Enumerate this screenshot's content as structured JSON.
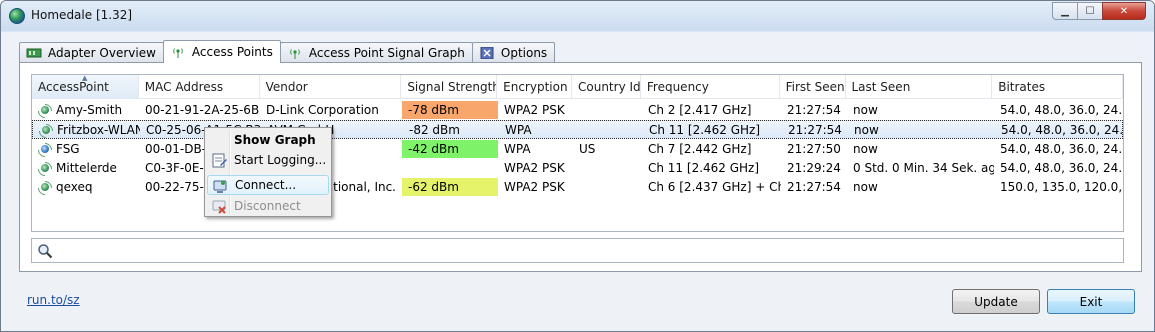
{
  "window": {
    "title": "Homedale [1.32]"
  },
  "title_buttons": {
    "minimize": "▁",
    "maximize": "☐",
    "close": "✕"
  },
  "tabs": [
    {
      "label": "Adapter Overview",
      "icon": "adapter-icon"
    },
    {
      "label": "Access Points",
      "icon": "antenna-icon"
    },
    {
      "label": "Access Point Signal Graph",
      "icon": "antenna-icon"
    },
    {
      "label": "Options",
      "icon": "options-icon"
    }
  ],
  "columns": [
    "AccessPoint",
    "MAC Address",
    "Vendor",
    "Signal Strength",
    "Encryption",
    "Country Id",
    "Frequency",
    "First Seen",
    "Last Seen",
    "Bitrates"
  ],
  "rows": [
    {
      "name": "Amy-Smith",
      "mac": "00-21-91-2A-25-6B",
      "vendor": "D-Link Corporation",
      "signal": "-78 dBm",
      "signal_color": "#f9a66d",
      "enc": "WPA2 PSK",
      "country": "",
      "freq": "Ch 2 [2.417 GHz]",
      "first": "21:27:54",
      "last": "now",
      "bitrates": "54.0, 48.0, 36.0, 24.0,..."
    },
    {
      "name": "Fritzbox-WLAN",
      "mac": "C0-25-06-A1-5C-B3",
      "vendor": "AVM GmbH",
      "signal": "-82 dBm",
      "signal_color": "",
      "enc": "WPA",
      "country": "",
      "freq": "Ch 11 [2.462 GHz]",
      "first": "21:27:54",
      "last": "now",
      "bitrates": "54.0, 48.0, 36.0, 24.0,..."
    },
    {
      "name": "FSG",
      "mac": "00-01-DB-0",
      "vendor": "",
      "signal": "-42 dBm",
      "signal_color": "#7ef36a",
      "enc": "WPA",
      "country": "US",
      "freq": "Ch 7 [2.442 GHz]",
      "first": "21:27:50",
      "last": "now",
      "bitrates": "54.0, 48.0, 36.0, 24.0,..."
    },
    {
      "name": "Mittelerde",
      "mac": "C0-3F-0E-C",
      "vendor": "",
      "signal": "",
      "signal_color": "",
      "enc": "WPA2 PSK",
      "country": "",
      "freq": "Ch 11 [2.462 GHz]",
      "first": "21:29:24",
      "last": "0 Std. 0 Min. 34 Sek. ago",
      "bitrates": "54.0, 48.0, 36.0, 24.0,..."
    },
    {
      "name": "qexeq",
      "mac": "00-22-75-F3",
      "vendor": "ational, Inc.",
      "signal": "-62 dBm",
      "signal_color": "#e4f36a",
      "enc": "WPA2 PSK",
      "country": "",
      "freq": "Ch 6 [2.437 GHz] + Ch 2",
      "first": "21:27:54",
      "last": "now",
      "bitrates": "150.0, 135.0, 120.0, 9..."
    }
  ],
  "context_menu": {
    "show_graph": "Show Graph",
    "start_logging": "Start Logging...",
    "connect": "Connect...",
    "disconnect": "Disconnect"
  },
  "search": {
    "placeholder": ""
  },
  "footer": {
    "link": "run.to/sz",
    "update": "Update",
    "exit": "Exit"
  }
}
